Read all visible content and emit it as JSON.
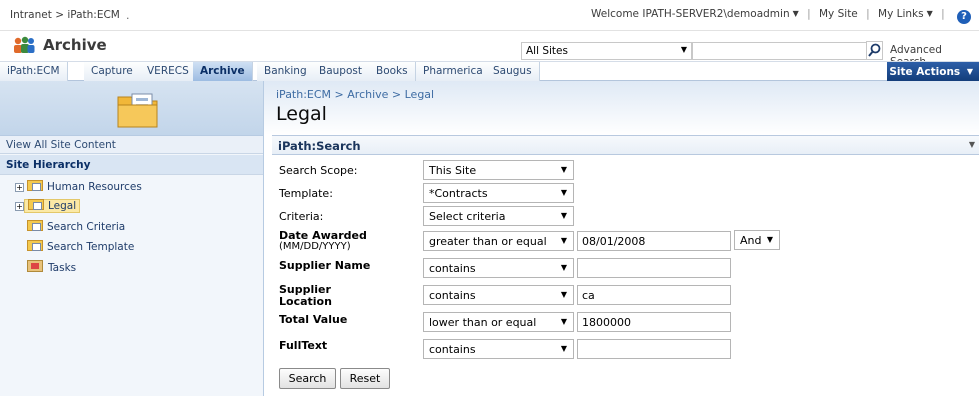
{
  "topbar": {
    "breadcrumb": "Intranet > iPath:ECM",
    "dot": ".",
    "welcome": "Welcome IPATH-SERVER2\\demoadmin",
    "my_site": "My Site",
    "my_links": "My Links",
    "help_glyph": "?"
  },
  "header": {
    "site_title": "Archive",
    "search_scope": "All Sites",
    "search_value": "",
    "advanced_search": "Advanced Search"
  },
  "nav": {
    "tabs": [
      {
        "label": "iPath:ECM"
      },
      {
        "label": "Capture"
      },
      {
        "label": "VERECS"
      },
      {
        "label": "Archive",
        "active": true
      },
      {
        "label": "Banking"
      },
      {
        "label": "Baupost"
      },
      {
        "label": "Books"
      },
      {
        "label": "Pharmerica"
      },
      {
        "label": "Saugus"
      }
    ],
    "site_actions": "Site Actions"
  },
  "page": {
    "breadcrumb": "iPath:ECM > Archive > Legal",
    "title": "Legal"
  },
  "leftnav": {
    "view_all": "View All Site Content",
    "hierarchy_heading": "Site Hierarchy",
    "items": [
      {
        "label": "Human Resources"
      },
      {
        "label": "Legal"
      },
      {
        "label": "Search Criteria"
      },
      {
        "label": "Search Template"
      },
      {
        "label": "Tasks"
      }
    ]
  },
  "webpart": {
    "title": "iPath:Search",
    "rows": {
      "scope": {
        "label": "Search Scope:",
        "value": "This Site"
      },
      "template": {
        "label": "Template:",
        "value": "*Contracts"
      },
      "criteria": {
        "label": "Criteria:",
        "value": "Select criteria"
      },
      "date_awarded": {
        "label": "Date Awarded",
        "sublabel": "(MM/DD/YYYY)",
        "operator": "greater than or equal",
        "value": "08/01/2008",
        "conjunction": "And"
      },
      "supplier_name": {
        "label": "Supplier Name",
        "operator": "contains",
        "value": ""
      },
      "supplier_location": {
        "label": "Supplier",
        "label2": "Location",
        "operator": "contains",
        "value": "ca"
      },
      "total_value": {
        "label": "Total Value",
        "operator": "lower than or equal",
        "value": "1800000"
      },
      "fulltext": {
        "label": "FullText",
        "operator": "contains",
        "value": ""
      }
    },
    "search_button": "Search",
    "reset_button": "Reset"
  },
  "colors": {
    "accent": "#1f5fb8",
    "site_actions_bg": "#133d7a",
    "active_tab": "#9dbce2"
  }
}
